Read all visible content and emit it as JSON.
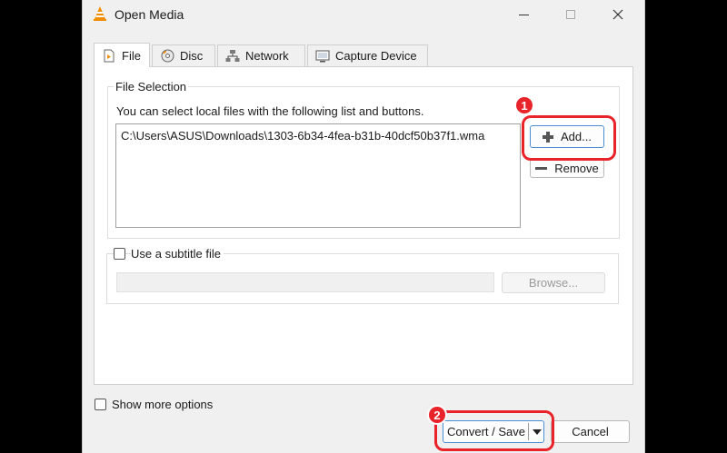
{
  "window": {
    "title": "Open Media",
    "controls": {
      "minimize": "minimize",
      "maximize": "maximize",
      "close": "close"
    }
  },
  "tabs": [
    {
      "label": "File",
      "icon": "file-icon",
      "active": true
    },
    {
      "label": "Disc",
      "icon": "disc-icon",
      "active": false
    },
    {
      "label": "Network",
      "icon": "network-icon",
      "active": false
    },
    {
      "label": "Capture Device",
      "icon": "capture-device-icon",
      "active": false
    }
  ],
  "file_selection": {
    "legend": "File Selection",
    "description": "You can select local files with the following list and buttons.",
    "files": [
      "C:\\Users\\ASUS\\Downloads\\1303-6b34-4fea-b31b-40dcf50b37f1.wma"
    ],
    "add_label": "Add...",
    "remove_label": "Remove"
  },
  "subtitle": {
    "checkbox_label": "Use a subtitle file",
    "checked": false,
    "path_value": "",
    "browse_label": "Browse..."
  },
  "show_more_options": {
    "label": "Show more options",
    "checked": false
  },
  "footer": {
    "convert_save_label": "Convert / Save",
    "cancel_label": "Cancel"
  },
  "annotations": {
    "step1": "1",
    "step2": "2",
    "highlight_color": "#e8242a"
  },
  "colors": {
    "window_bg": "#f0f0f0",
    "background": "#000000",
    "vlc_orange": "#f28c00"
  }
}
